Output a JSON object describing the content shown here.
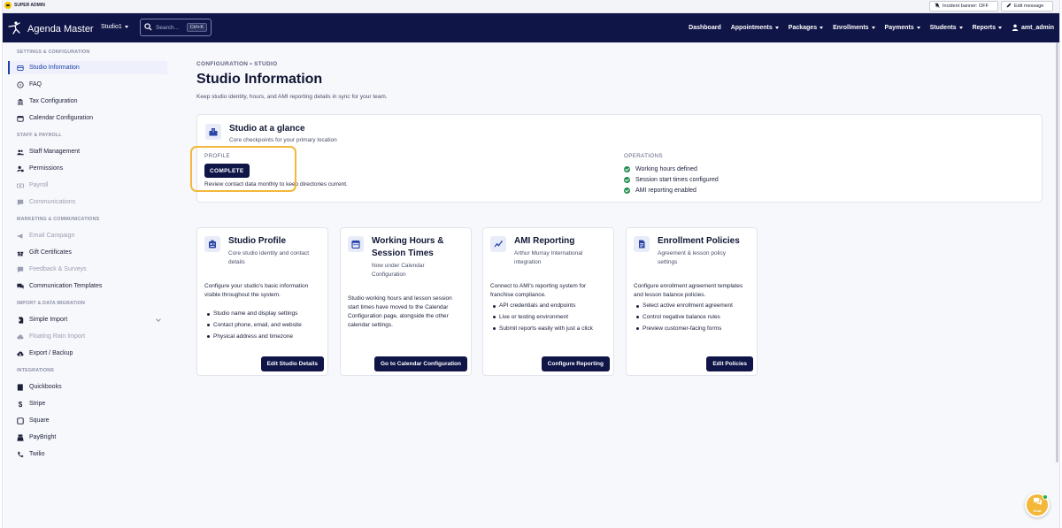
{
  "admin_bar": {
    "badge": "SUPER ADMIN",
    "incident_banner": "Incident banner: OFF",
    "edit_message": "Edit message"
  },
  "nav": {
    "brand": "Agenda Master",
    "studio": "Studio1",
    "search_placeholder": "Search...",
    "search_shortcut": "Ctrl+K",
    "links": [
      "Dashboard",
      "Appointments",
      "Packages",
      "Enrollments",
      "Payments",
      "Students",
      "Reports"
    ],
    "user": "amt_admin"
  },
  "sidebar": {
    "sections": [
      "SETTINGS & CONFIGURATION",
      "STAFF & PAYROLL",
      "MARKETING & COMMUNICATIONS",
      "IMPORT & DATA MIGRATION",
      "INTEGRATIONS"
    ],
    "items": [
      "Studio Information",
      "FAQ",
      "Tax Configuration",
      "Calendar Configuration",
      "Staff Management",
      "Permissions",
      "Payroll",
      "Communications",
      "Email Campaign",
      "Gift Certificates",
      "Feedback & Surveys",
      "Communication Templates",
      "Simple Import",
      "Floating Rain Import",
      "Export / Backup",
      "Quickbooks",
      "Stripe",
      "Square",
      "PayBright",
      "Twilio"
    ]
  },
  "page": {
    "breadcrumb": "CONFIGURATION • STUDIO",
    "title": "Studio Information",
    "subtitle": "Keep studio identity, hours, and AMI reporting details in sync for your team."
  },
  "glance": {
    "title": "Studio at a glance",
    "subtitle": "Core checkpoints for your primary location",
    "profile_label": "PROFILE",
    "profile_status": "COMPLETE",
    "profile_note": "Review contact data monthly to keep directories current.",
    "operations_label": "OPERATIONS",
    "operations": [
      "Working hours defined",
      "Session start times configured",
      "AMI reporting enabled"
    ]
  },
  "cards": [
    {
      "title": "Studio Profile",
      "subtitle": "Core studio identity and contact details",
      "description": "Configure your studio's basic information visible throughout the system.",
      "bullets": [
        "Studio name and display settings",
        "Contact phone, email, and website",
        "Physical address and timezone"
      ],
      "button": "Edit Studio Details"
    },
    {
      "title": "Working Hours & Session Times",
      "subtitle": "Now under Calendar Configuration",
      "description": "Studio working hours and lesson session start times have moved to the Calendar Configuration page, alongside the other calendar settings.",
      "bullets": [],
      "button": "Go to Calendar Configuration"
    },
    {
      "title": "AMI Reporting",
      "subtitle": "Arthur Murray International integration",
      "description": "Connect to AMI's reporting system for franchise compliance.",
      "bullets": [
        "API credentials and endpoints",
        "Live or testing environment",
        "Submit reports easily with just a click"
      ],
      "button": "Configure Reporting"
    },
    {
      "title": "Enrollment Policies",
      "subtitle": "Agreement & lesson policy settings",
      "description": "Configure enrollment agreement templates and lesson balance policies.",
      "bullets": [
        "Select active enrollment agreement",
        "Control negative balance rules",
        "Preview customer-facing forms"
      ],
      "button": "Edit Policies"
    }
  ],
  "chat": {
    "label": "Chat"
  }
}
